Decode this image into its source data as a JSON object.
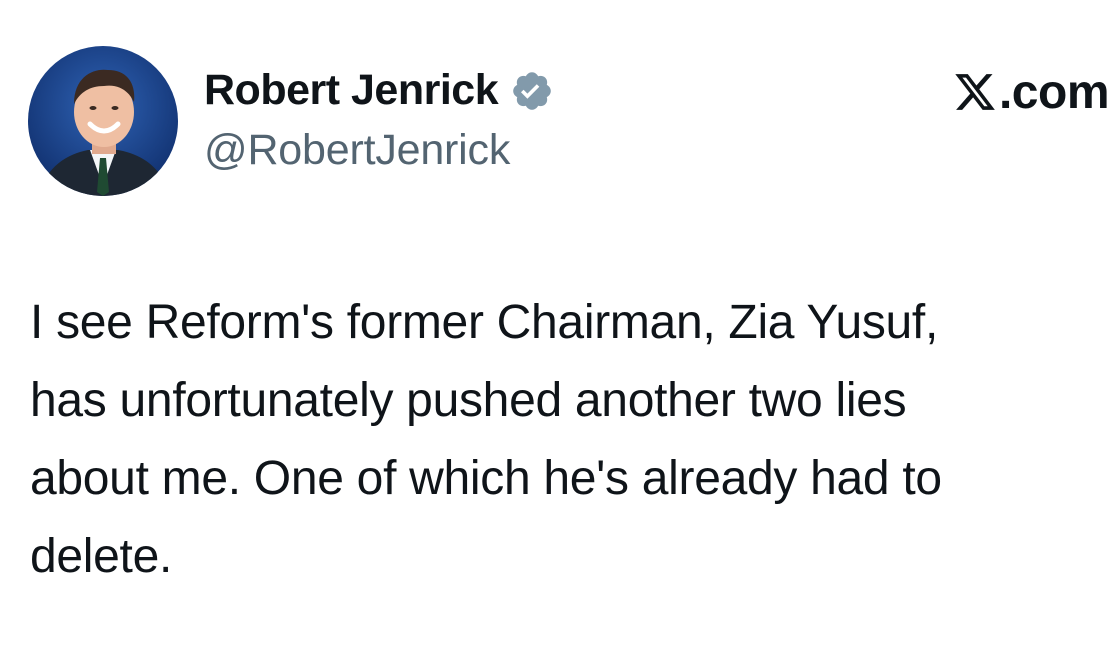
{
  "author": {
    "display_name": "Robert Jenrick",
    "handle": "@RobertJenrick",
    "verified_icon": "verified-badge-icon",
    "avatar_icon": "profile-photo"
  },
  "site": {
    "label": ".com",
    "logo": "x-logo-icon"
  },
  "tweet": {
    "lines": [
      "I see Reform's former Chairman, Zia Yusuf,",
      "has unfortunately pushed another two lies",
      "about me. One of which he's already had to",
      "delete."
    ]
  },
  "colors": {
    "text": "#0f1419",
    "secondary": "#536471",
    "verified_badge": "#829aab"
  }
}
